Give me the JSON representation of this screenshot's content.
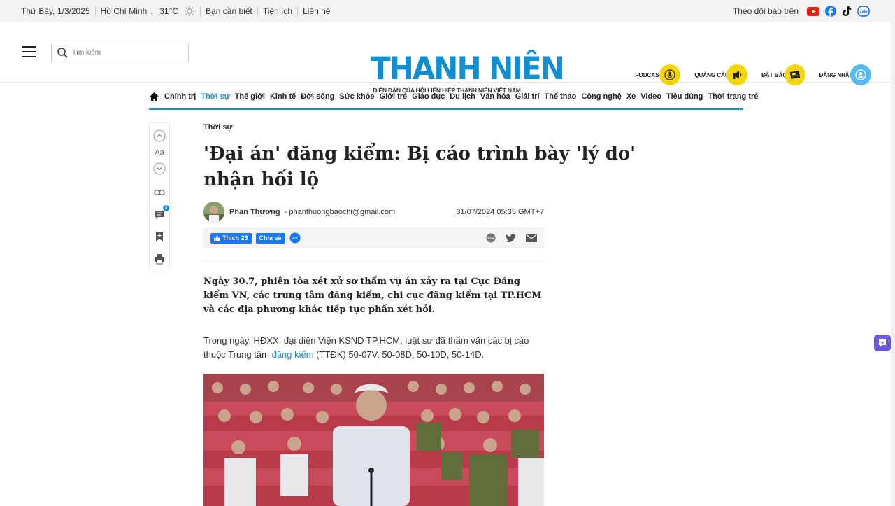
{
  "topbar": {
    "date": "Thứ Bảy, 1/3/2025",
    "city": "Hồ Chí Minh",
    "temperature": "31°C",
    "links": [
      "Bạn cần biết",
      "Tiện ích",
      "Liên hệ"
    ],
    "follow_label": "Theo dõi báo trên",
    "socials": [
      "youtube-icon",
      "facebook-icon",
      "tiktok-icon",
      "zalo-icon"
    ]
  },
  "header": {
    "search_placeholder": "Tìm kiếm",
    "logo": "THANH NIÊN",
    "logo_tagline": "DIỄN ĐÀN CỦA HỘI LIÊN HIỆP THANH NIÊN VIỆT NAM",
    "actions": [
      {
        "label": "PODCAST",
        "icon": "microphone-icon"
      },
      {
        "label": "QUẢNG CÁO",
        "icon": "megaphone-icon"
      },
      {
        "label": "ĐẶT BÁO",
        "icon": "newspaper-icon"
      },
      {
        "label": "ĐĂNG NHẬP",
        "icon": "user-icon"
      }
    ]
  },
  "nav": {
    "items": [
      "Chính trị",
      "Thời sự",
      "Thế giới",
      "Kinh tế",
      "Đời sống",
      "Sức khỏe",
      "Giới trẻ",
      "Giáo dục",
      "Du lịch",
      "Văn hóa",
      "Giải trí",
      "Thể thao",
      "Công nghệ",
      "Xe",
      "Video",
      "Tiêu dùng",
      "Thời trang trẻ"
    ],
    "active": "Thời sự"
  },
  "tools": {
    "font_label": "Aa",
    "comment_count": "3"
  },
  "article": {
    "category": "Thời sự",
    "title": "'Đại án' đăng kiểm: Bị cáo trình bày 'lý do' nhận hối lộ",
    "author": "Phan Thương",
    "email": "- phanthuongbaochi@gmail.com",
    "published": "31/07/2024 05:35 GMT+7",
    "like_label": "Thích 23",
    "share_label": "Chia sẻ",
    "sapo": "Ngày 30.7, phiên tòa xét xử sơ thẩm vụ án xảy ra tại Cục Đăng kiểm VN, các trung tâm đăng kiểm, chi cục đăng kiểm tại TP.HCM và các địa phương khác tiếp tục phần xét hỏi.",
    "body_before_link": "Trong ngày, HĐXX, đại diện Viện KSND TP.HCM, luật sư đã thẩm vấn các bị cáo thuộc Trung tâm ",
    "body_link": "đăng kiểm",
    "body_after_link": " (TTĐK) 50-07V, 50-08D, 50-10D, 50-14D."
  },
  "colors": {
    "brand_blue": "#0f8fd2",
    "action_yellow": "#f5d60b",
    "facebook_blue": "#1877f2"
  }
}
